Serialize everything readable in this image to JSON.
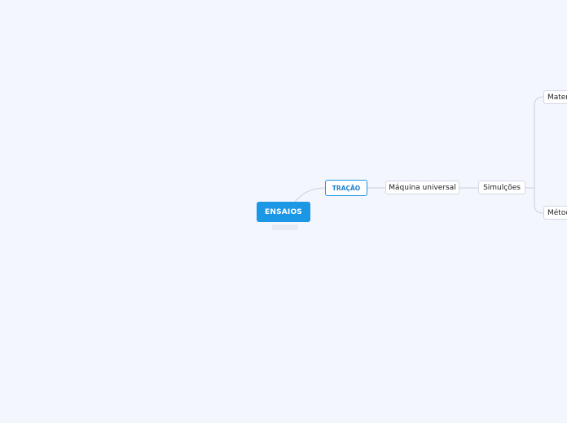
{
  "mindmap": {
    "root": {
      "label": "ENSAIOS"
    },
    "main_topic": {
      "label": "TRAÇÃO"
    },
    "nodes": [
      {
        "label": "Máquina universal"
      },
      {
        "label": "Simulções"
      },
      {
        "label": "Materi"
      },
      {
        "label": "Métod"
      }
    ]
  },
  "colors": {
    "background": "#f3f6fd",
    "root_fill": "#1b97e5",
    "main_topic_border": "#1b97e5",
    "connector": "#c9cfdb"
  }
}
